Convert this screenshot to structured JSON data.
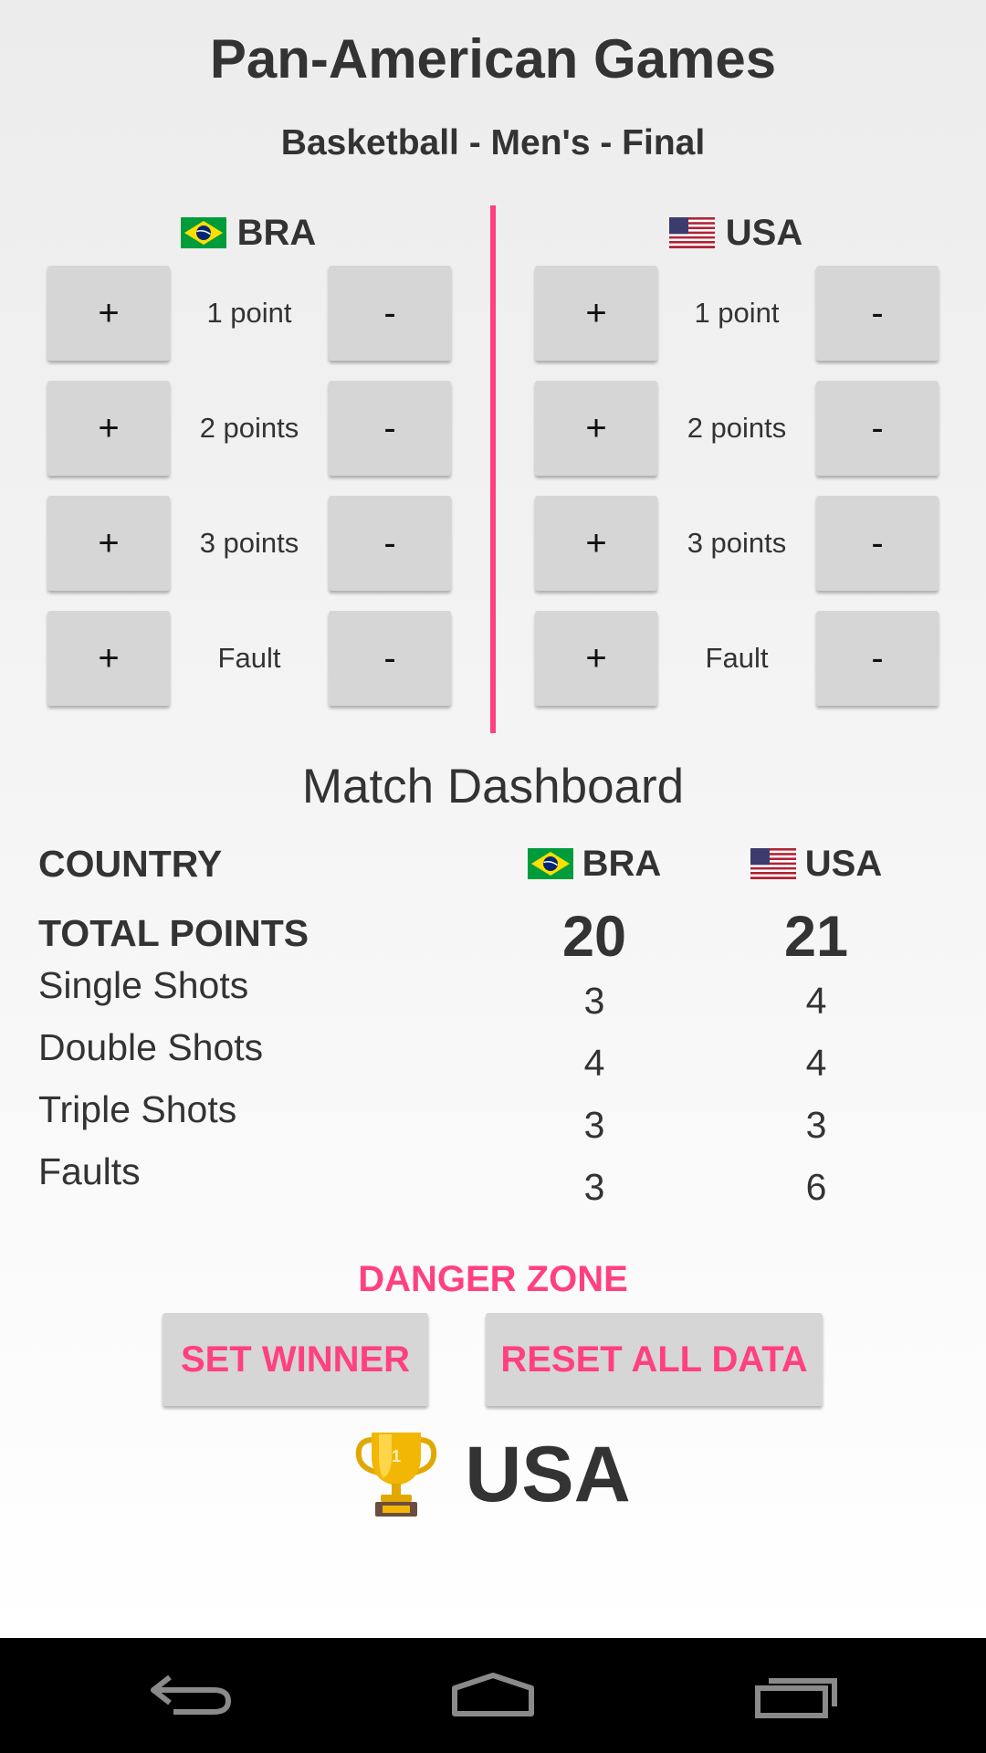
{
  "header": {
    "title": "Pan-American Games",
    "subtitle": "Basketball - Men's - Final"
  },
  "teams": [
    {
      "code": "BRA",
      "flag": "brazil-flag-icon",
      "controls": [
        {
          "label": "1 point",
          "plus": "+",
          "minus": "-"
        },
        {
          "label": "2 points",
          "plus": "+",
          "minus": "-"
        },
        {
          "label": "3 points",
          "plus": "+",
          "minus": "-"
        },
        {
          "label": "Fault",
          "plus": "+",
          "minus": "-"
        }
      ]
    },
    {
      "code": "USA",
      "flag": "usa-flag-icon",
      "controls": [
        {
          "label": "1 point",
          "plus": "+",
          "minus": "-"
        },
        {
          "label": "2 points",
          "plus": "+",
          "minus": "-"
        },
        {
          "label": "3 points",
          "plus": "+",
          "minus": "-"
        },
        {
          "label": "Fault",
          "plus": "+",
          "minus": "-"
        }
      ]
    }
  ],
  "dashboard": {
    "title": "Match Dashboard",
    "country_label": "COUNTRY",
    "total_label": "TOTAL POINTS",
    "rows": [
      {
        "label": "Single Shots",
        "bra": "3",
        "usa": "4"
      },
      {
        "label": "Double Shots",
        "bra": "4",
        "usa": "4"
      },
      {
        "label": "Triple Shots",
        "bra": "3",
        "usa": "3"
      },
      {
        "label": "Faults",
        "bra": "3",
        "usa": "6"
      }
    ],
    "bra": {
      "code": "BRA",
      "total": "20"
    },
    "usa": {
      "code": "USA",
      "total": "21"
    }
  },
  "danger_zone": {
    "title": "DANGER ZONE",
    "set_winner_label": "SET WINNER",
    "reset_label": "RESET ALL DATA"
  },
  "winner": {
    "icon": "trophy-icon",
    "name": "USA"
  },
  "navbar": {
    "icons": [
      "back-icon",
      "home-icon",
      "recents-icon"
    ]
  },
  "colors": {
    "accent": "#ff4081",
    "button_bg": "#d6d6d6",
    "text": "#333333",
    "navbar_bg": "#000000"
  }
}
